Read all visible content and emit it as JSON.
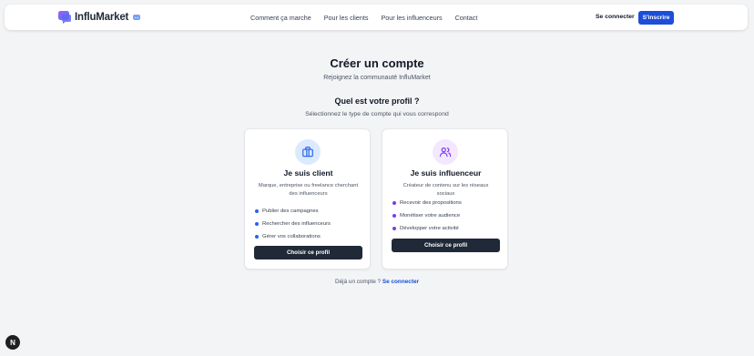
{
  "brand": {
    "name": "InfluMarket"
  },
  "nav": {
    "links": [
      "Comment ça marche",
      "Pour les clients",
      "Pour les influenceurs",
      "Contact"
    ],
    "login": "Se connecter",
    "signup": "S'inscrire"
  },
  "main": {
    "title": "Créer un compte",
    "subtitle": "Rejoignez la communauté InfluMarket",
    "profile_question": "Quel est votre profil ?",
    "profile_hint": "Sélectionnez le type de compte qui vous correspond"
  },
  "cards": [
    {
      "icon": "briefcase-icon",
      "title": "Je suis client",
      "description": "Marque, entreprise ou freelance cherchant des influenceurs",
      "features": [
        "Publier des campagnes",
        "Rechercher des influenceurs",
        "Gérer vos collaborations"
      ],
      "button": "Choisir ce profil",
      "accent": "#2563eb",
      "icon_bg": "#dbeafe"
    },
    {
      "icon": "users-icon",
      "title": "Je suis influenceur",
      "description": "Créateur de contenu sur les réseaux sociaux",
      "features": [
        "Recevoir des propositions",
        "Monétiser votre audience",
        "Développer votre activité"
      ],
      "button": "Choisir ce profil",
      "accent": "#7c3aed",
      "icon_bg": "#f3e8ff"
    }
  ],
  "footer": {
    "prompt": "Déjà un compte ?",
    "link": "Se connecter"
  },
  "dev_badge": {
    "label": "N",
    "icon": "next-logo-icon"
  }
}
